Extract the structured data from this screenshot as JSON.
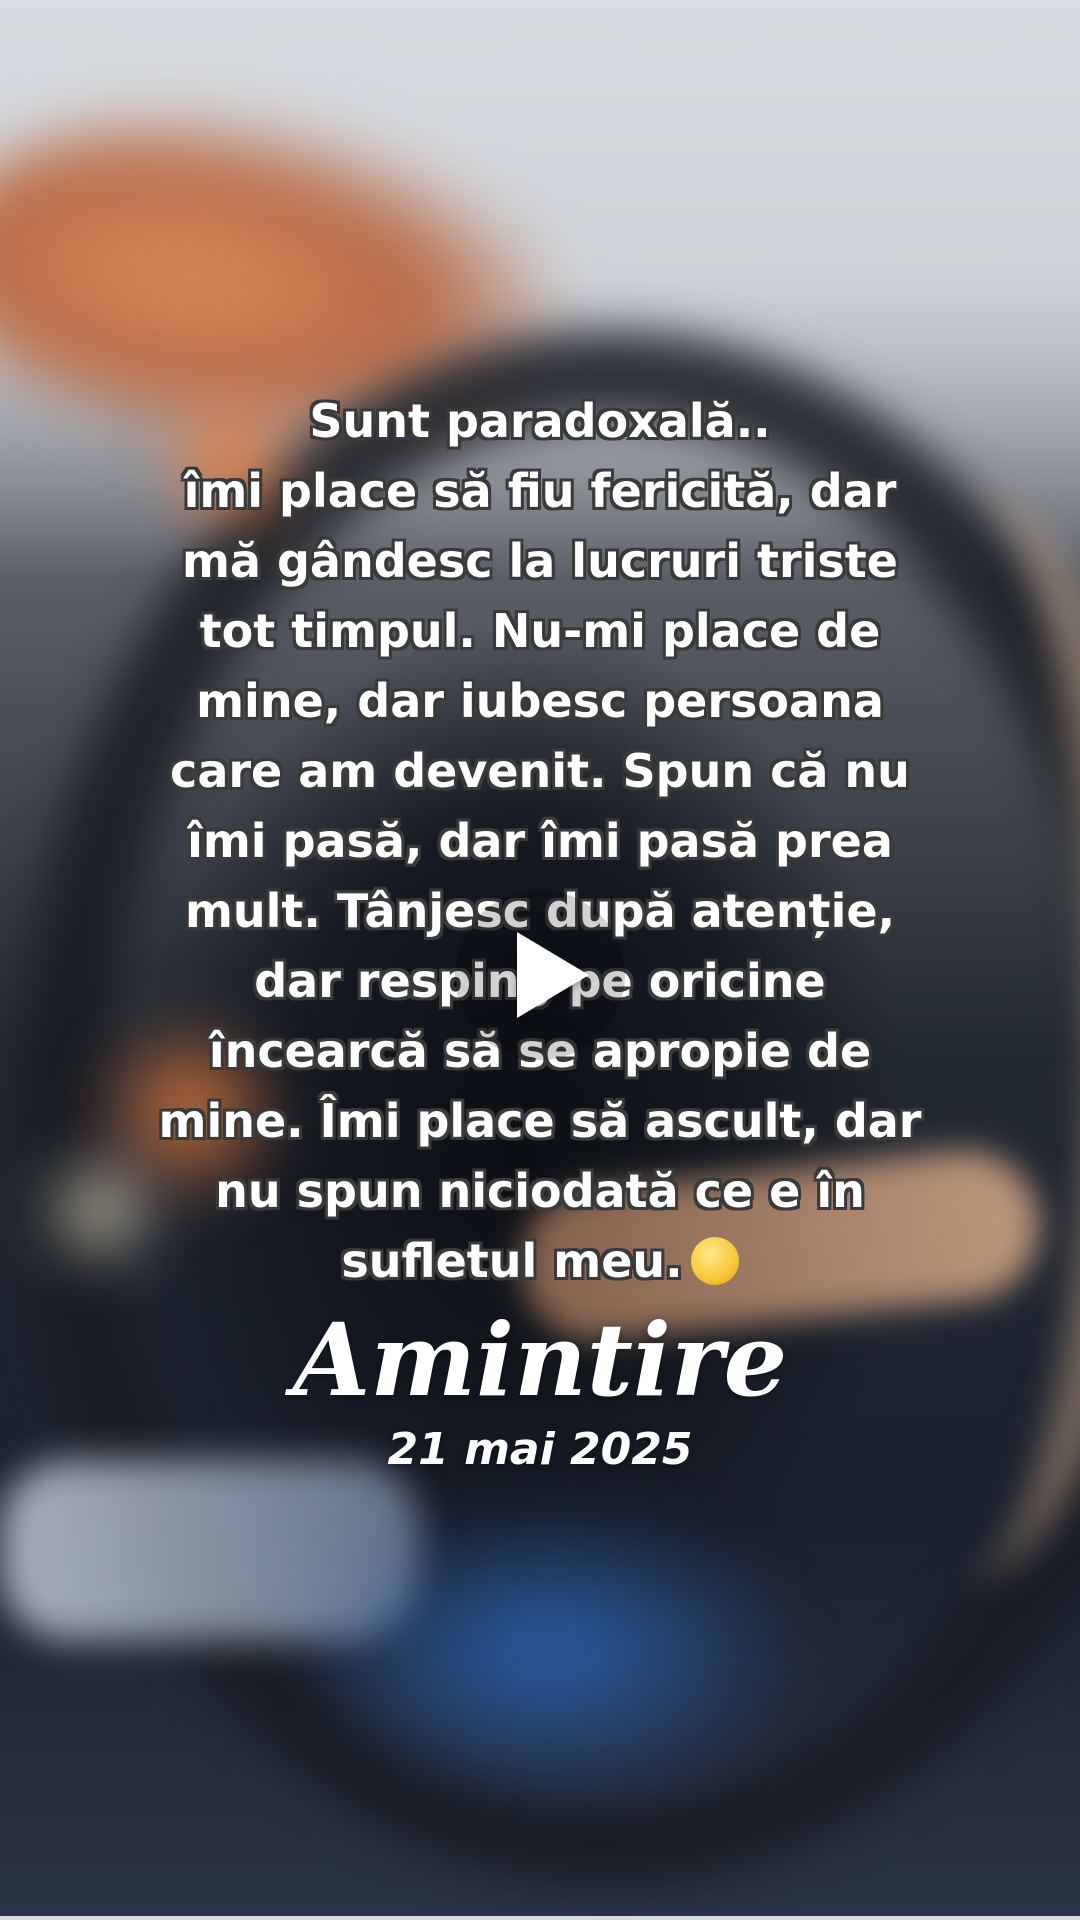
{
  "post": {
    "quote_lines": [
      "Sunt paradoxală..",
      "îmi place să fiu fericită, dar",
      "mă gândesc la lucruri triste",
      "tot timpul. Nu-mi place de",
      "mine, dar iubesc persoana",
      "care am devenit. Spun că nu",
      "îmi pasă, dar îmi pasă prea",
      "mult. Tânjesc după atenție,",
      "dar resping pe oricine",
      "încearcă să se apropie de",
      "mine. Îmi place să ascult, dar",
      "nu spun niciodată ce e în",
      "sufletul meu."
    ],
    "emoji": "face-holding-back-tears"
  },
  "memory": {
    "title": "Amintire",
    "date": "21 mai 2025"
  },
  "player": {
    "control": "play-icon"
  }
}
